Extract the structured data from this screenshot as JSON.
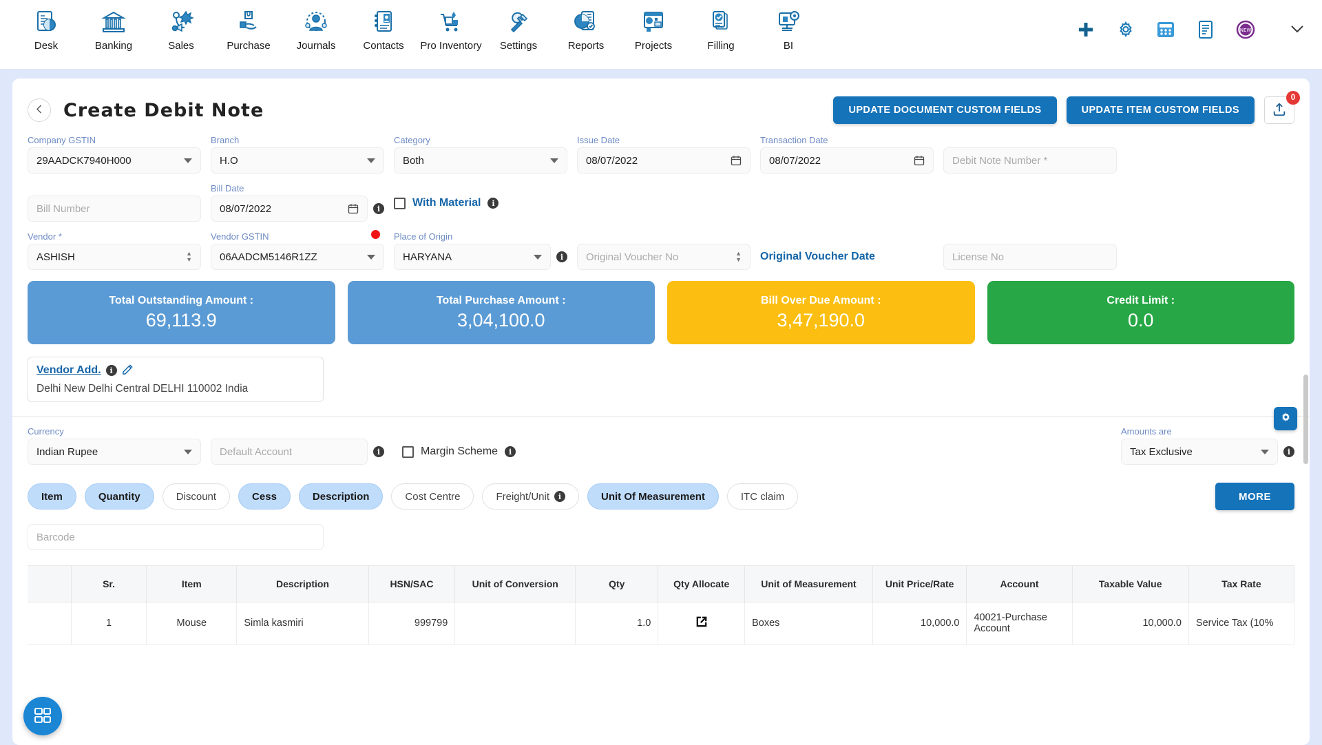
{
  "topnav": {
    "items": [
      {
        "label": "Desk",
        "icon": "dashboard-icon"
      },
      {
        "label": "Banking",
        "icon": "bank-icon"
      },
      {
        "label": "Sales",
        "icon": "sales-icon"
      },
      {
        "label": "Purchase",
        "icon": "purchase-icon"
      },
      {
        "label": "Journals",
        "icon": "journals-icon"
      },
      {
        "label": "Contacts",
        "icon": "contacts-icon"
      },
      {
        "label": "Pro Inventory",
        "icon": "inventory-icon"
      },
      {
        "label": "Settings",
        "icon": "settings-icon"
      },
      {
        "label": "Reports",
        "icon": "reports-icon"
      },
      {
        "label": "Projects",
        "icon": "projects-icon"
      },
      {
        "label": "Filling",
        "icon": "filling-icon"
      },
      {
        "label": "BI",
        "icon": "bi-icon"
      }
    ],
    "right_icons": [
      "plus-icon",
      "gear-icon",
      "calculator-icon",
      "notes-icon",
      "new-badge-icon",
      "chevron-down-icon"
    ]
  },
  "page": {
    "title": "Create Debit Note",
    "back_icon": "chevron-left-icon",
    "btn_update_document": "UPDATE DOCUMENT CUSTOM FIELDS",
    "btn_update_item": "UPDATE ITEM CUSTOM FIELDS",
    "upload_icon": "upload-icon",
    "upload_badge": "0"
  },
  "form": {
    "company_gstin": {
      "label": "Company GSTIN",
      "value": "29AADCK7940H000"
    },
    "branch": {
      "label": "Branch",
      "value": "H.O"
    },
    "category": {
      "label": "Category",
      "value": "Both"
    },
    "issue_date": {
      "label": "Issue Date",
      "value": "08/07/2022"
    },
    "transaction_date": {
      "label": "Transaction Date",
      "value": "08/07/2022"
    },
    "debit_note_number": {
      "label": "",
      "placeholder": "Debit Note Number *"
    },
    "bill_number": {
      "label": "",
      "placeholder": "Bill Number"
    },
    "bill_date": {
      "label": "Bill Date",
      "value": "08/07/2022"
    },
    "with_material": {
      "label": "With Material",
      "checked": false
    },
    "vendor": {
      "label": "Vendor *",
      "value": "ASHISH"
    },
    "vendor_gstin": {
      "label": "Vendor GSTIN",
      "value": "06AADCM5146R1ZZ"
    },
    "place_of_origin": {
      "label": "Place of Origin",
      "value": "HARYANA"
    },
    "original_voucher_no": {
      "label": "",
      "placeholder": "Original Voucher No"
    },
    "original_voucher_date": {
      "label": "Original Voucher Date"
    },
    "license_no": {
      "label": "",
      "placeholder": "License No"
    }
  },
  "stats": [
    {
      "title": "Total Outstanding Amount :",
      "value": "69,113.9",
      "color": "#5b9bd5"
    },
    {
      "title": "Total Purchase Amount :",
      "value": "3,04,100.0",
      "color": "#5b9bd5"
    },
    {
      "title": "Bill Over Due Amount :",
      "value": "3,47,190.0",
      "color": "#fcbf11"
    },
    {
      "title": "Credit Limit :",
      "value": "0.0",
      "color": "#27a745"
    }
  ],
  "vendor_address": {
    "link": "Vendor Add.",
    "info_icon": "info-icon",
    "edit_icon": "edit-icon",
    "body": "Delhi New Delhi Central DELHI 110002 India"
  },
  "currency_row": {
    "currency": {
      "label": "Currency",
      "value": "Indian Rupee"
    },
    "default_account": {
      "placeholder": "Default Account"
    },
    "margin_scheme": {
      "label": "Margin Scheme",
      "checked": false
    },
    "amounts_are": {
      "label": "Amounts are",
      "value": "Tax Exclusive"
    },
    "gear_fab_icon": "gear-icon"
  },
  "chips": [
    {
      "label": "Item",
      "selected": true
    },
    {
      "label": "Quantity",
      "selected": true
    },
    {
      "label": "Discount",
      "selected": false
    },
    {
      "label": "Cess",
      "selected": true
    },
    {
      "label": "Description",
      "selected": true
    },
    {
      "label": "Cost Centre",
      "selected": false
    },
    {
      "label": "Freight/Unit",
      "selected": false,
      "info": true
    },
    {
      "label": "Unit Of Measurement",
      "selected": true
    },
    {
      "label": "ITC claim",
      "selected": false
    }
  ],
  "more_button": "MORE",
  "barcode": {
    "placeholder": "Barcode"
  },
  "table": {
    "columns": [
      "",
      "Sr.",
      "Item",
      "Description",
      "HSN/SAC",
      "Unit of Conversion",
      "Qty",
      "Qty Allocate",
      "Unit of Measurement",
      "Unit Price/Rate",
      "Account",
      "Taxable Value",
      "Tax Rate"
    ],
    "rows": [
      {
        "sr": "1",
        "item": "Mouse",
        "description": "Simla kasmiri",
        "hsn": "999799",
        "unit_of_conversion": "",
        "qty": "1.0",
        "qty_allocate_icon": "external-link-icon",
        "uom": "Boxes",
        "unit_price": "10,000.0",
        "account": "40021-Purchase Account",
        "taxable_value": "10,000.0",
        "tax_rate": "Service Tax (10%"
      }
    ]
  },
  "fab": {
    "icon": "grid-apps-icon"
  }
}
